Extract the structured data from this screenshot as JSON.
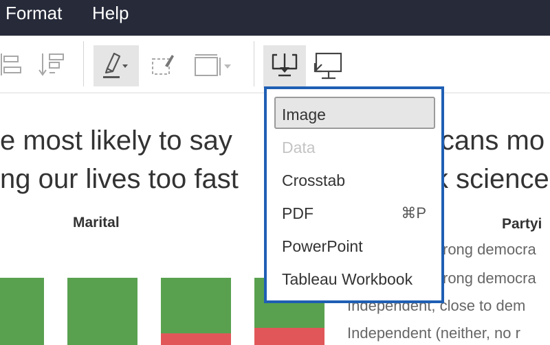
{
  "menubar": {
    "items": [
      {
        "label": "Format"
      },
      {
        "label": "Help"
      }
    ]
  },
  "toolbar": {
    "icons": [
      "align-left-icon",
      "sort-descending-icon",
      "highlighter-icon",
      "format-brush-icon",
      "fit-view-icon",
      "download-icon",
      "presentation-icon"
    ]
  },
  "dashboard": {
    "left_title": [
      "e most likely to say",
      "ng our lives too fast"
    ],
    "right_title": [
      "icans mo",
      "k science"
    ],
    "left_section_label": "Marital",
    "right_section_label": "Partyi",
    "legend": [
      "rong democra",
      "rong democra",
      "Independent, close to dem",
      "Independent (neither, no r"
    ],
    "colors": {
      "green": "#59a14f",
      "red": "#e15759"
    }
  },
  "export_menu": {
    "items": [
      {
        "label": "Image",
        "state": "highlighted"
      },
      {
        "label": "Data",
        "state": "disabled"
      },
      {
        "label": "Crosstab",
        "state": "enabled"
      },
      {
        "label": "PDF",
        "state": "enabled",
        "shortcut": "⌘P"
      },
      {
        "label": "PowerPoint",
        "state": "enabled"
      },
      {
        "label": "Tableau Workbook",
        "state": "enabled"
      }
    ],
    "border_color": "#1f5fb4"
  }
}
